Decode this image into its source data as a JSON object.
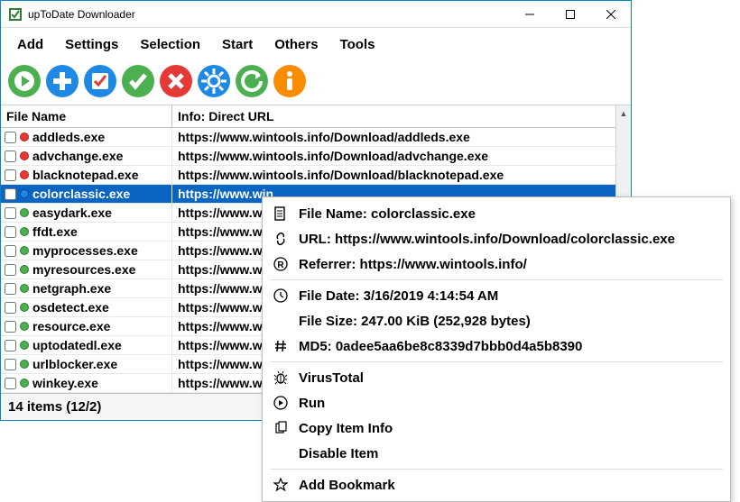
{
  "app": {
    "title": "upToDate Downloader"
  },
  "menu": {
    "add": "Add",
    "settings": "Settings",
    "selection": "Selection",
    "start": "Start",
    "others": "Others",
    "tools": "Tools"
  },
  "cols": {
    "file": "File Name",
    "url": "Info: Direct URL"
  },
  "rows": [
    {
      "dot": "red",
      "name": "addleds.exe",
      "url": "https://www.wintools.info/Download/addleds.exe",
      "sel": false
    },
    {
      "dot": "red",
      "name": "advchange.exe",
      "url": "https://www.wintools.info/Download/advchange.exe",
      "sel": false
    },
    {
      "dot": "red",
      "name": "blacknotepad.exe",
      "url": "https://www.wintools.info/Download/blacknotepad.exe",
      "sel": false
    },
    {
      "dot": "blu",
      "name": "colorclassic.exe",
      "url": "https://www.win",
      "sel": true
    },
    {
      "dot": "grn",
      "name": "easydark.exe",
      "url": "https://www.win",
      "sel": false
    },
    {
      "dot": "grn",
      "name": "ffdt.exe",
      "url": "https://www.win",
      "sel": false
    },
    {
      "dot": "grn",
      "name": "myprocesses.exe",
      "url": "https://www.win",
      "sel": false
    },
    {
      "dot": "grn",
      "name": "myresources.exe",
      "url": "https://www.win",
      "sel": false
    },
    {
      "dot": "grn",
      "name": "netgraph.exe",
      "url": "https://www.win",
      "sel": false
    },
    {
      "dot": "grn",
      "name": "osdetect.exe",
      "url": "https://www.win",
      "sel": false
    },
    {
      "dot": "grn",
      "name": "resource.exe",
      "url": "https://www.win",
      "sel": false
    },
    {
      "dot": "grn",
      "name": "uptodatedl.exe",
      "url": "https://www.win",
      "sel": false
    },
    {
      "dot": "grn",
      "name": "urlblocker.exe",
      "url": "https://www.win",
      "sel": false
    },
    {
      "dot": "grn",
      "name": "winkey.exe",
      "url": "https://www.win",
      "sel": false
    }
  ],
  "status": "14 items (12/2)",
  "ctx": {
    "fn_label": "File Name: colorclassic.exe",
    "url_label": "URL: https://www.wintools.info/Download/colorclassic.exe",
    "ref_label": "Referrer: https://www.wintools.info/",
    "date_label": "File Date: 3/16/2019 4:14:54 AM",
    "size_label": "File Size: 247.00 KiB (252,928 bytes)",
    "md5_label": "MD5: 0adee5aa6be8c8339d7bbb0d4a5b8390",
    "vt": "VirusTotal",
    "run": "Run",
    "copy": "Copy Item Info",
    "disable": "Disable Item",
    "bookmark": "Add Bookmark"
  }
}
